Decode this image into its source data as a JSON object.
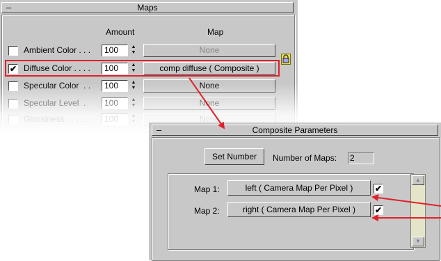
{
  "maps_rollout": {
    "title": "Maps",
    "collapse_symbol": "–",
    "col_amount": "Amount",
    "col_map": "Map",
    "rows": [
      {
        "label": "Ambient Color . . .",
        "checked": false,
        "amount": "100",
        "map": "None",
        "map_disabled": true
      },
      {
        "label": "Diffuse Color . . . .",
        "checked": true,
        "amount": "100",
        "map": "comp diffuse  ( Composite )",
        "map_disabled": false
      },
      {
        "label": "Specular Color  . .",
        "checked": false,
        "amount": "100",
        "map": "None",
        "map_disabled": false
      },
      {
        "label": "Specular Level  .",
        "checked": false,
        "amount": "100",
        "map": "None",
        "map_disabled": false
      },
      {
        "label": "Glossiness . . . . .",
        "checked": false,
        "amount": "100",
        "map": "None",
        "map_disabled": false
      }
    ],
    "lock_icon": "lock-icon"
  },
  "composite": {
    "title": "Composite Parameters",
    "collapse_symbol": "–",
    "set_number_label": "Set Number",
    "num_maps_label": "Number of Maps:",
    "num_maps_value": "2",
    "maps": [
      {
        "label": "Map 1:",
        "value": "left  ( Camera Map Per Pixel )",
        "checked": true
      },
      {
        "label": "Map 2:",
        "value": "right  ( Camera Map Per Pixel )",
        "checked": true
      }
    ]
  },
  "colors": {
    "panel_bg": "#c8c8c8",
    "highlight": "#e0202a"
  }
}
